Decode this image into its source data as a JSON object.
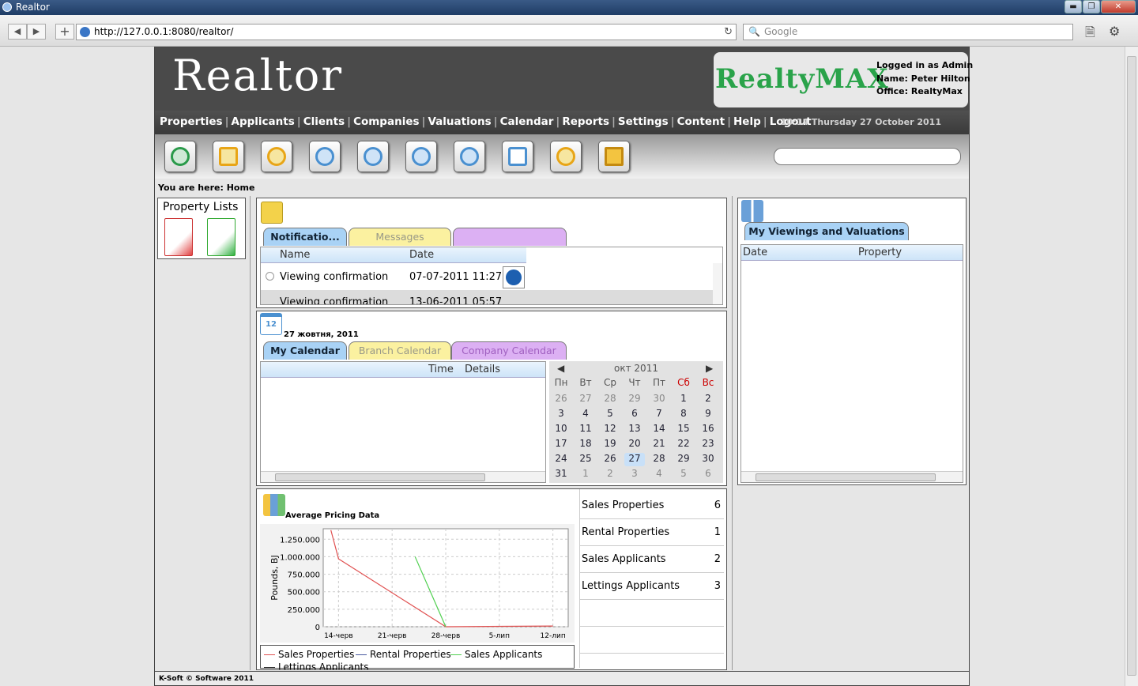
{
  "window": {
    "title": "Realtor",
    "min": "▬",
    "max": "❐",
    "close": "✕"
  },
  "browser": {
    "back": "◀",
    "forward": "▶",
    "new_tab": "+",
    "url": "http://127.0.0.1:8080/realtor/",
    "reload": "↻",
    "search_placeholder": "Google",
    "search_glyph": "🔍",
    "page_icon": "🗎",
    "tools_icon": "⚙"
  },
  "header": {
    "logo": "Realtor",
    "brand": "RealtyMAX",
    "logged_in": "Logged in as Admin",
    "name_label": "Name:",
    "name": "Peter Hilton",
    "office_label": "Office:",
    "office": "RealtyMax"
  },
  "menu": {
    "items": [
      "Properties",
      "Applicants",
      "Clients",
      "Companies",
      "Valuations",
      "Calendar",
      "Reports",
      "Settings",
      "Content",
      "Help",
      "Logout"
    ],
    "clock": "10:14 Thursday 27 October 2011"
  },
  "breadcrumb": "You are here: Home",
  "property_lists": {
    "title": "Property Lists"
  },
  "notifications": {
    "tabs": [
      "Notificatio...",
      "Messages",
      ""
    ],
    "columns": [
      "Name",
      "Date"
    ],
    "rows": [
      {
        "name": "Viewing confirmation",
        "date": "07-07-2011 11:27"
      },
      {
        "name": "Viewing confirmation",
        "date": "13-06-2011 05:57"
      }
    ]
  },
  "calendar": {
    "date_label": "27 жовтня, 2011",
    "tabs": [
      "My Calendar",
      "Branch Calendar",
      "Company Calendar"
    ],
    "columns": [
      "Time",
      "Details"
    ],
    "month": "окт 2011",
    "weekdays": [
      "Пн",
      "Вт",
      "Ср",
      "Чт",
      "Пт",
      "Сб",
      "Вс"
    ],
    "weeks": [
      [
        "26",
        "27",
        "28",
        "29",
        "30",
        "1",
        "2"
      ],
      [
        "3",
        "4",
        "5",
        "6",
        "7",
        "8",
        "9"
      ],
      [
        "10",
        "11",
        "12",
        "13",
        "14",
        "15",
        "16"
      ],
      [
        "17",
        "18",
        "19",
        "20",
        "21",
        "22",
        "23"
      ],
      [
        "24",
        "25",
        "26",
        "27",
        "28",
        "29",
        "30"
      ],
      [
        "31",
        "1",
        "2",
        "3",
        "4",
        "5",
        "6"
      ]
    ],
    "today": "27",
    "icon_day": "12"
  },
  "viewings": {
    "tab": "My Viewings and Valuations",
    "columns": [
      "Date",
      "Property"
    ]
  },
  "chart_data": {
    "type": "line",
    "title": "Average Pricing Data",
    "ylabel": "Pounds, BJ",
    "xlabel": "",
    "x_ticks": [
      "14-черв",
      "21-черв",
      "28-черв",
      "5-лип",
      "12-лип"
    ],
    "y_ticks": [
      "0",
      "250.000",
      "500.000",
      "750.000",
      "1.000.000",
      "1.250.000"
    ],
    "ylim": [
      0,
      1400000
    ],
    "x": [
      0,
      7,
      14,
      21,
      28
    ],
    "series": [
      {
        "name": "Sales Properties",
        "color": "#e05050",
        "points": [
          [
            -1,
            1380000
          ],
          [
            0,
            970000
          ],
          [
            14,
            0
          ],
          [
            28,
            10000
          ]
        ]
      },
      {
        "name": "Rental Properties",
        "color": "#4a5aa0",
        "points": []
      },
      {
        "name": "Sales Applicants",
        "color": "#50d050",
        "points": [
          [
            10,
            1000000
          ],
          [
            14,
            0
          ]
        ]
      },
      {
        "name": "Lettings Applicants",
        "color": "#333333",
        "points": []
      }
    ]
  },
  "stats": [
    {
      "label": "Sales Properties",
      "value": "6"
    },
    {
      "label": "Rental Properties",
      "value": "1"
    },
    {
      "label": "Sales Applicants",
      "value": "2"
    },
    {
      "label": "Lettings Applicants",
      "value": "3"
    }
  ],
  "footer": "K-Soft © Software 2011"
}
